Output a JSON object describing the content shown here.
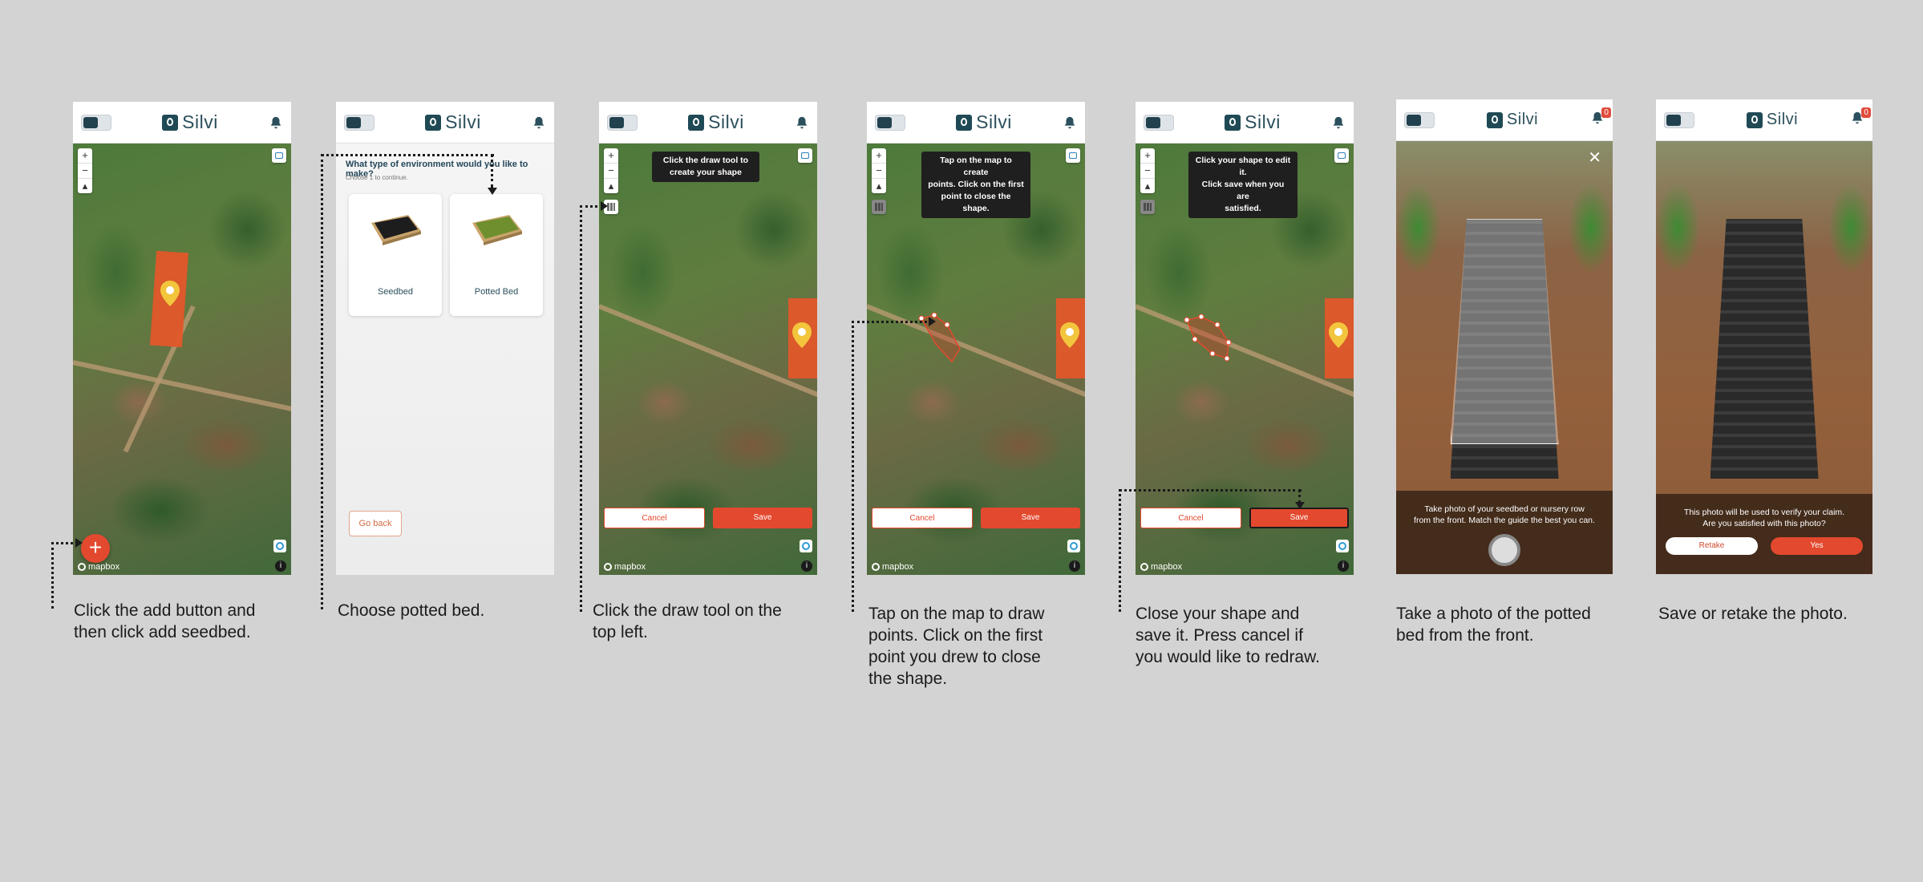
{
  "app": {
    "name": "Silvi"
  },
  "map": {
    "attribution": "mapbox",
    "zoom_in": "+",
    "zoom_out": "−",
    "reset": "▴",
    "info": "i"
  },
  "panels": [
    {
      "id": 1,
      "caption": [
        "Click the add button and",
        "then click add seedbed."
      ],
      "fab": "+"
    },
    {
      "id": 2,
      "caption": [
        "Choose potted bed."
      ],
      "question": "What type of environment would you like to make?",
      "subquestion": "Choose 1 to continue.",
      "options": [
        "Seedbed",
        "Potted Bed"
      ],
      "back": "Go back"
    },
    {
      "id": 3,
      "caption": [
        "Click the draw tool on the",
        "top left."
      ],
      "tooltip": [
        "Click the draw tool to",
        "create your shape"
      ],
      "cancel": "Cancel",
      "save": "Save"
    },
    {
      "id": 4,
      "caption": [
        "Tap on the map to draw",
        "points. Click on the first",
        "point you drew to close",
        "the shape."
      ],
      "tooltip": [
        "Tap on the map to create",
        "points. Click on the first",
        "point to close the shape."
      ],
      "cancel": "Cancel",
      "save": "Save"
    },
    {
      "id": 5,
      "caption": [
        "Close your shape and",
        "save it. Press cancel if",
        "you would like to redraw."
      ],
      "tooltip": [
        "Click your shape to edit it.",
        "Click save when you are",
        "satisfied."
      ],
      "cancel": "Cancel",
      "save": "Save"
    },
    {
      "id": 6,
      "caption": [
        "Take a photo of the potted",
        "bed from the front."
      ],
      "notif_count": "0",
      "close": "✕",
      "instruction": [
        "Take photo of your seedbed or nursery row",
        "from the front. Match the guide the best you can."
      ]
    },
    {
      "id": 7,
      "caption": [
        "Save or retake the photo."
      ],
      "notif_count": "0",
      "instruction": [
        "This photo will be used to verify your claim.",
        "Are you satisfied with this photo?"
      ],
      "retake": "Retake",
      "yes": "Yes"
    }
  ],
  "colors": {
    "brand": "#2b4f5c",
    "accent": "#e3492e",
    "background": "#d3d3d3"
  }
}
